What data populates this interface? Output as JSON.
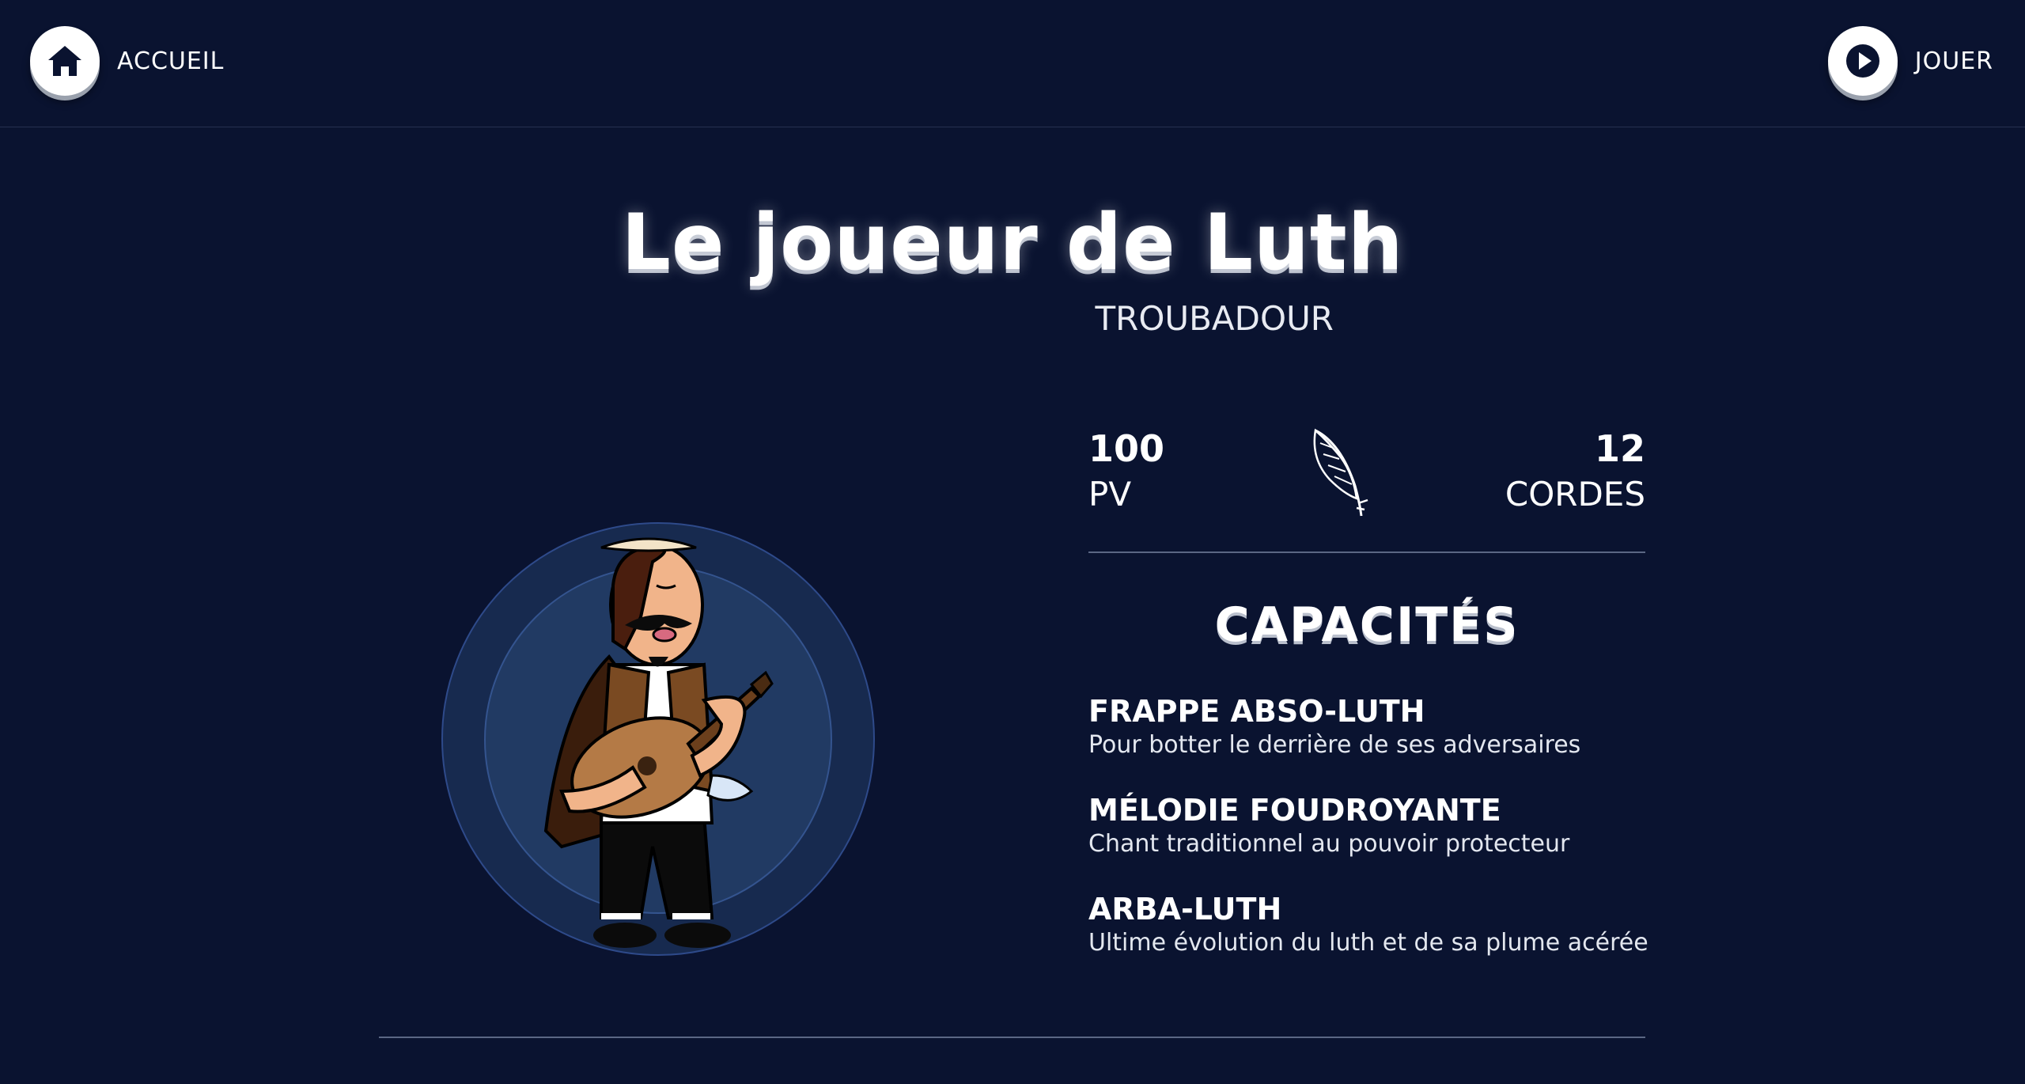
{
  "header": {
    "home_label": "ACCUEIL",
    "play_label": "JOUER"
  },
  "character": {
    "name": "Le joueur de Luth",
    "class": "TROUBADOUR"
  },
  "stats": {
    "hp_value": "100",
    "hp_label": "PV",
    "resource_value": "12",
    "resource_label": "CORDES",
    "resource_icon": "feather-icon"
  },
  "abilities": {
    "title": "CAPACITÉS",
    "items": [
      {
        "name": "FRAPPE ABSO-LUTH",
        "description": "Pour botter le derrière de ses adversaires"
      },
      {
        "name": "MÉLODIE FOUDROYANTE",
        "description": "Chant traditionnel au pouvoir protecteur"
      },
      {
        "name": "ARBA-LUTH",
        "description": "Ultime évolution du luth et de sa plume acérée"
      }
    ]
  },
  "colors": {
    "background": "#0a1330",
    "portrait_outer": "#172a4f",
    "portrait_inner": "#213a63",
    "text": "#ffffff"
  }
}
